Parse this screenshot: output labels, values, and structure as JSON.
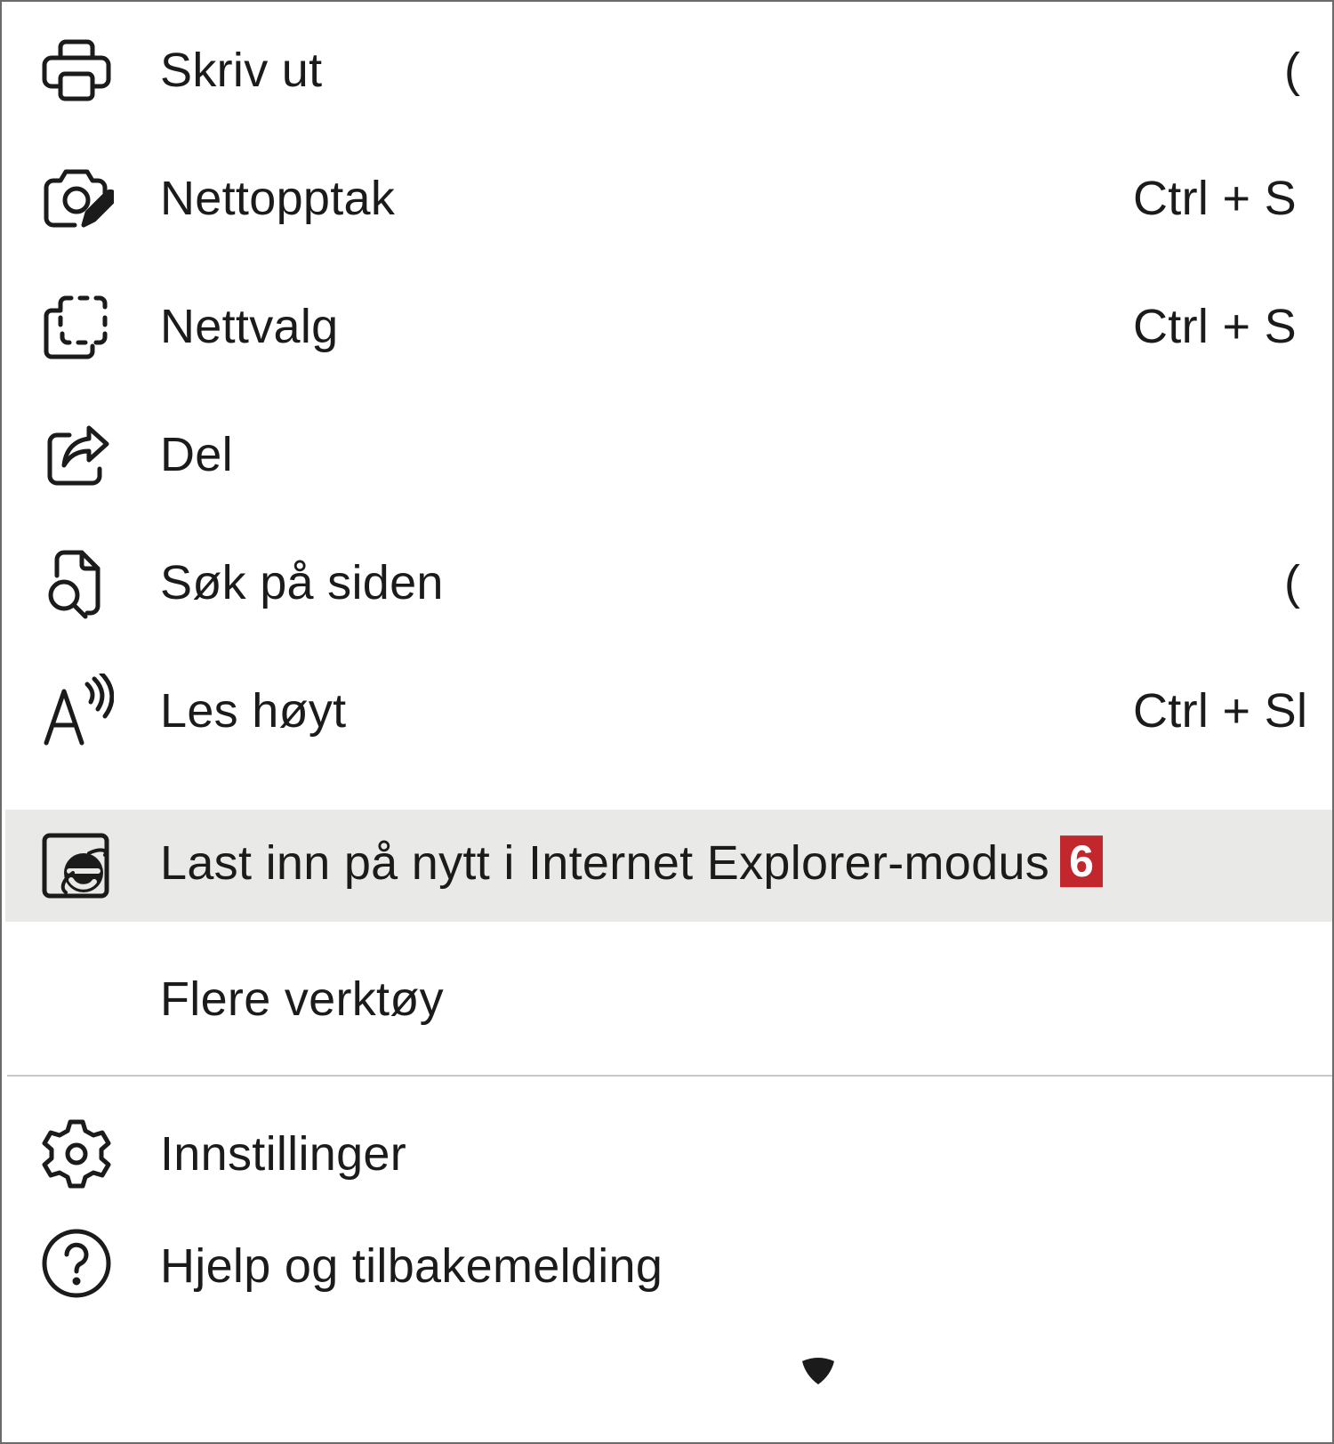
{
  "menu": {
    "items": [
      {
        "label": "Skriv ut",
        "shortcut": "",
        "icon": "printer-icon"
      },
      {
        "label": "Nettopptak",
        "shortcut": "Ctrl + S",
        "icon": "web-capture-icon"
      },
      {
        "label": "Nettvalg",
        "shortcut": "Ctrl + S",
        "icon": "web-select-icon"
      },
      {
        "label": "Del",
        "shortcut": "",
        "icon": "share-icon"
      },
      {
        "label": "Søk på siden",
        "shortcut": "",
        "icon": "find-on-page-icon"
      },
      {
        "label": "Les høyt",
        "shortcut": "Ctrl + Sl",
        "icon": "read-aloud-icon"
      },
      {
        "label": "Last inn på nytt i Internet Explorer-modus",
        "shortcut": "",
        "icon": "internet-explorer-icon",
        "badge": "6",
        "highlighted": true
      },
      {
        "label": "Flere verktøy",
        "shortcut": "",
        "icon": ""
      },
      {
        "label": "Innstillinger",
        "shortcut": "",
        "icon": "settings-gear-icon"
      },
      {
        "label": "Hjelp og tilbakemelding",
        "shortcut": "",
        "icon": "help-icon"
      }
    ],
    "colors": {
      "highlight": "#e9e9e7",
      "badge": "#c2272d",
      "text": "#1b1b1b"
    }
  }
}
